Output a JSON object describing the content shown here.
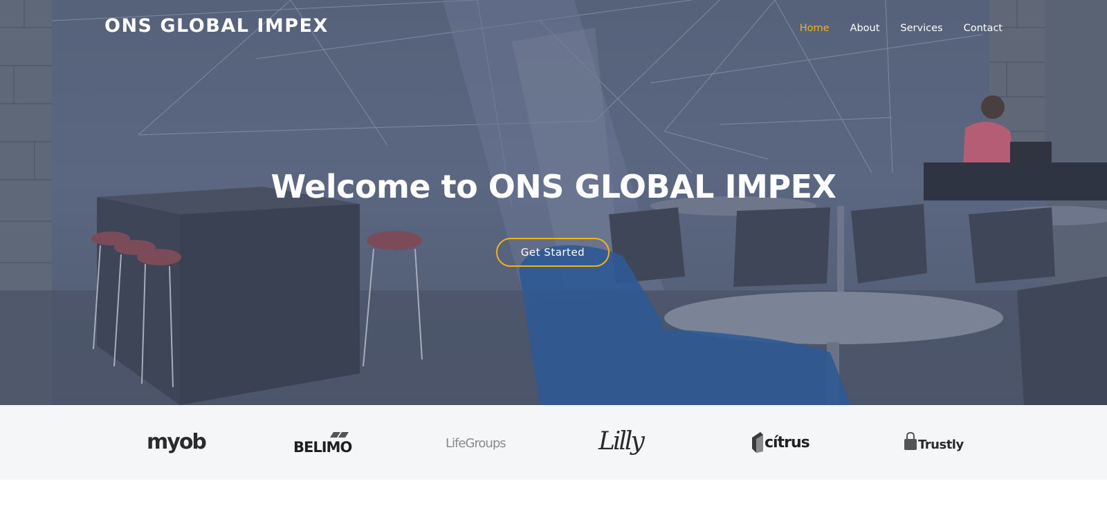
{
  "header": {
    "logo": "ONS GLOBAL IMPEX",
    "nav": [
      {
        "label": "Home",
        "active": true
      },
      {
        "label": "About",
        "active": false
      },
      {
        "label": "Services",
        "active": false
      },
      {
        "label": "Contact",
        "active": false
      }
    ]
  },
  "hero": {
    "title": "Welcome to ONS GLOBAL IMPEX",
    "cta_label": "Get Started"
  },
  "clients": [
    {
      "name": "myob"
    },
    {
      "name": "BELIMO"
    },
    {
      "name": "LifeGroups"
    },
    {
      "name": "Lilly"
    },
    {
      "name": "cítrus"
    },
    {
      "name": "Trustly"
    }
  ],
  "colors": {
    "accent": "#f0b419",
    "hero_overlay": "#56627a",
    "clients_background": "#f5f6f8",
    "text_light": "#ffffff"
  }
}
